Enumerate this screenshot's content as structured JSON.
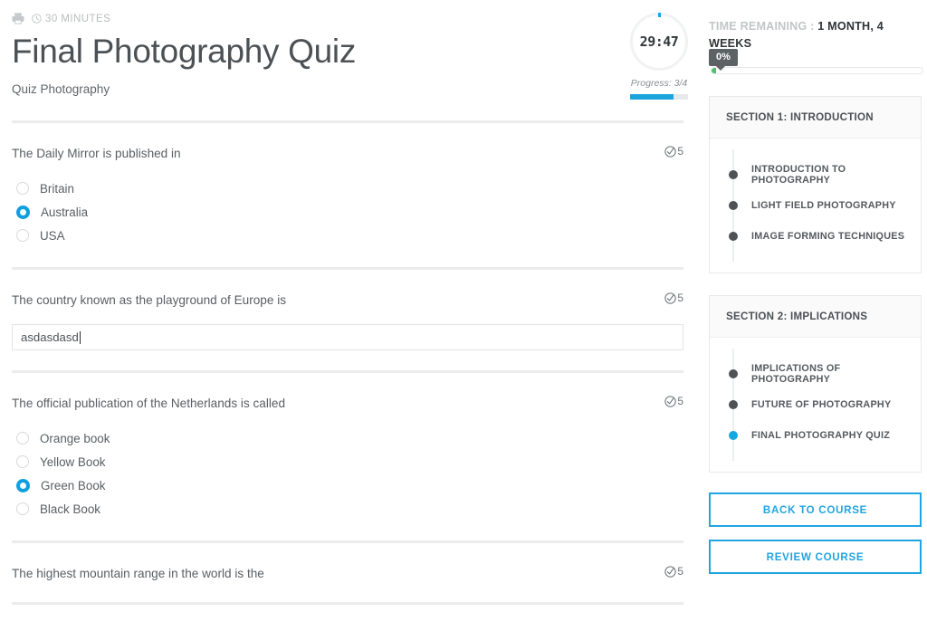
{
  "meta": {
    "print_icon": "printer-icon",
    "clock_icon": "clock-icon",
    "duration": "30 MINUTES"
  },
  "header": {
    "title": "Final Photography Quiz",
    "subtitle": "Quiz Photography"
  },
  "timer": {
    "value": "29:47",
    "progress_label": "Progress: 3/4",
    "progress_percent": 75,
    "accent_color": "#1aa3dd"
  },
  "sidebar": {
    "time_remaining_label": "TIME REMAINING :",
    "time_remaining_value": "1 MONTH, 4 WEEKS",
    "course_progress": {
      "bubble": "0%",
      "percent": 2,
      "fill_color": "#4cc06e"
    },
    "sections": [
      {
        "title": "SECTION 1: INTRODUCTION",
        "items": [
          {
            "label": "INTRODUCTION TO PHOTOGRAPHY",
            "active": false
          },
          {
            "label": "LIGHT FIELD PHOTOGRAPHY",
            "active": false
          },
          {
            "label": "IMAGE FORMING TECHNIQUES",
            "active": false
          }
        ]
      },
      {
        "title": "SECTION 2: IMPLICATIONS",
        "items": [
          {
            "label": "IMPLICATIONS OF PHOTOGRAPHY",
            "active": false
          },
          {
            "label": "FUTURE OF PHOTOGRAPHY",
            "active": false
          },
          {
            "label": "FINAL PHOTOGRAPHY QUIZ",
            "active": true
          }
        ]
      }
    ],
    "buttons": [
      {
        "label": "BACK TO COURSE"
      },
      {
        "label": "REVIEW COURSE"
      }
    ],
    "button_color": "#21a5e0"
  },
  "questions": [
    {
      "text": "The Daily Mirror is published in",
      "points": "5",
      "points_icon": "check-circle-icon",
      "type": "radio",
      "options": [
        {
          "label": "Britain",
          "selected": false
        },
        {
          "label": "Australia",
          "selected": true
        },
        {
          "label": "USA",
          "selected": false
        }
      ]
    },
    {
      "text": "The country known as the playground of Europe is",
      "points": "5",
      "points_icon": "check-circle-icon",
      "type": "text",
      "value": "asdasdasd",
      "placeholder": ""
    },
    {
      "text": "The official publication of the Netherlands is called",
      "points": "5",
      "points_icon": "check-circle-icon",
      "type": "radio",
      "options": [
        {
          "label": "Orange book",
          "selected": false
        },
        {
          "label": "Yellow Book",
          "selected": false
        },
        {
          "label": "Green Book",
          "selected": true
        },
        {
          "label": "Black Book",
          "selected": false
        }
      ]
    },
    {
      "text": "The highest mountain range in the world is the",
      "points": "5",
      "points_icon": "check-circle-icon",
      "type": "radio",
      "options": []
    }
  ]
}
